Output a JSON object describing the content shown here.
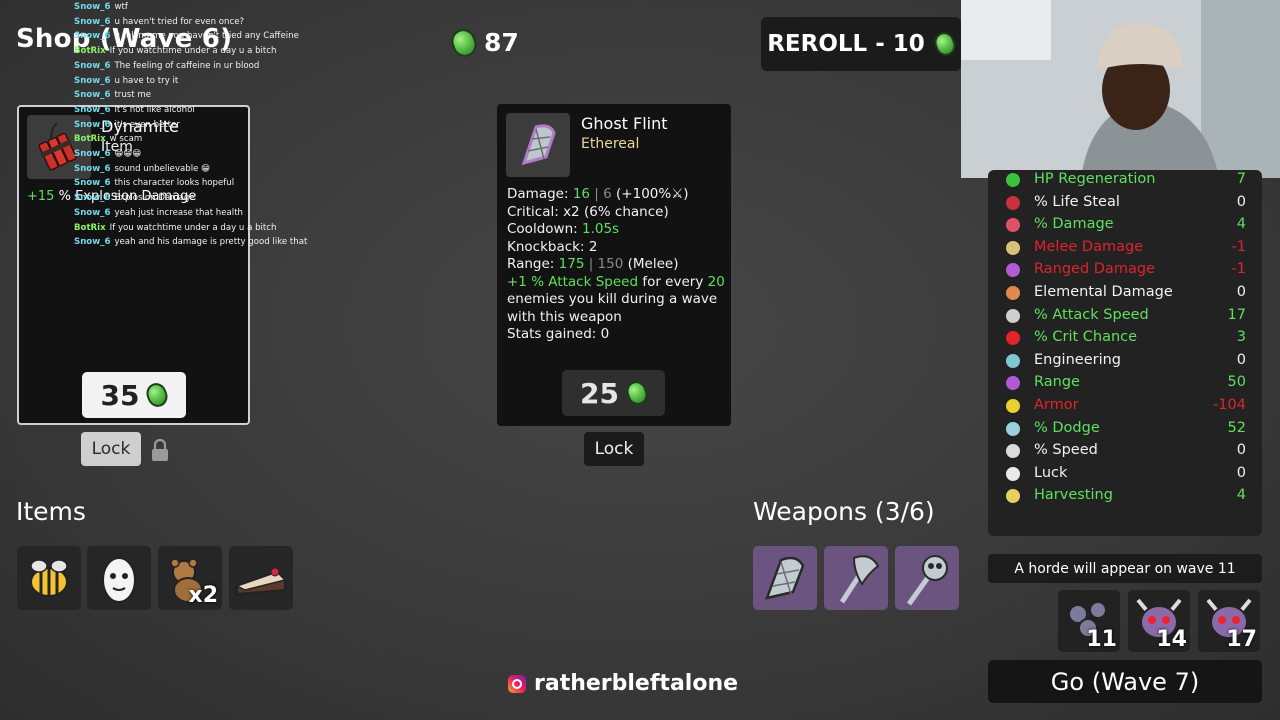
{
  "header": {
    "shop_title": "Shop (Wave 6)",
    "materials": "87",
    "reroll_label": "REROLL - 10"
  },
  "chat": [
    {
      "user": "Snow_6",
      "msg": "wtf"
    },
    {
      "user": "Snow_6",
      "msg": "u haven't tried for even once?"
    },
    {
      "user": "Snow_6",
      "msg": "u telling me you haven't tried any Caffeine"
    },
    {
      "user": "BotRix",
      "msg": "If you watchtime under a day u a bitch"
    },
    {
      "user": "Snow_6",
      "msg": "The feeling of caffeine in ur blood"
    },
    {
      "user": "Snow_6",
      "msg": "u have to try it"
    },
    {
      "user": "Snow_6",
      "msg": "trust me"
    },
    {
      "user": "Snow_6",
      "msg": "it's not like alcohol"
    },
    {
      "user": "Snow_6",
      "msg": "it's even better"
    },
    {
      "user": "BotRix",
      "msg": "w scam"
    },
    {
      "user": "Snow_6",
      "msg": "😁😁😁"
    },
    {
      "user": "Snow_6",
      "msg": "sound unbelievable 😁"
    },
    {
      "user": "Snow_6",
      "msg": "this character looks hopeful"
    },
    {
      "user": "Snow_6",
      "msg": "Explosion Damage"
    },
    {
      "user": "Snow_6",
      "msg": "yeah just increase that health"
    },
    {
      "user": "BotRix",
      "msg": "If you watchtime under a day u a bitch"
    },
    {
      "user": "Snow_6",
      "msg": "yeah and his damage is pretty good like that"
    }
  ],
  "shop": [
    {
      "name": "Dynamite",
      "type": "Item",
      "effect_value": "+15",
      "effect_text": "% Explosion Damage",
      "price": "35",
      "lock_label": "Lock"
    },
    {
      "name": "Ghost Flint",
      "type": "Ethereal",
      "stats": {
        "damage_label": "Damage:",
        "damage_value": "16",
        "damage_base": "| 6",
        "damage_scale": "(+100%⚔)",
        "critical_label": "Critical:",
        "critical_mult": "x2",
        "critical_pct": "(6% chance)",
        "cooldown_label": "Cooldown:",
        "cooldown_value": "1.05s",
        "knockback_label": "Knockback:",
        "knockback_value": "2",
        "range_label": "Range:",
        "range_value": "175",
        "range_base": "| 150",
        "range_type": "(Melee)",
        "bonus_value": "+1 % Attack Speed",
        "bonus_text_1": "for every",
        "bonus_kills": "20",
        "bonus_text_2": "enemies you kill during a wave with this weapon",
        "gained": "Stats gained: 0"
      },
      "price": "25",
      "lock_label": "Lock"
    }
  ],
  "items": {
    "title": "Items",
    "slots": [
      {
        "icon": "bee-icon",
        "count": ""
      },
      {
        "icon": "egg-icon",
        "count": ""
      },
      {
        "icon": "teddy-bear-icon",
        "count": "x2"
      },
      {
        "icon": "cake-slice-icon",
        "count": ""
      }
    ]
  },
  "weapons": {
    "title": "Weapons (3/6)",
    "slots": [
      {
        "icon": "ghost-flint-icon"
      },
      {
        "icon": "ghost-axe-icon"
      },
      {
        "icon": "ghost-scepter-icon"
      }
    ]
  },
  "stats": [
    {
      "label": "HP Regeneration",
      "value": "7",
      "color": "green",
      "icon": "heart-icon"
    },
    {
      "label": "% Life Steal",
      "value": "0",
      "color": "white",
      "icon": "fang-icon"
    },
    {
      "label": "% Damage",
      "value": "4",
      "color": "green",
      "icon": "muscle-icon"
    },
    {
      "label": "Melee Damage",
      "value": "-1",
      "color": "red",
      "icon": "sword-icon"
    },
    {
      "label": "Ranged Damage",
      "value": "-1",
      "color": "red",
      "icon": "bow-icon"
    },
    {
      "label": "Elemental Damage",
      "value": "0",
      "color": "white",
      "icon": "flame-icon"
    },
    {
      "label": "% Attack Speed",
      "value": "17",
      "color": "green",
      "icon": "hourglass-icon"
    },
    {
      "label": "% Crit Chance",
      "value": "3",
      "color": "green",
      "icon": "crit-icon"
    },
    {
      "label": "Engineering",
      "value": "0",
      "color": "white",
      "icon": "wrench-icon"
    },
    {
      "label": "Range",
      "value": "50",
      "color": "green",
      "icon": "range-icon"
    },
    {
      "label": "Armor",
      "value": "-104",
      "color": "red",
      "icon": "shield-icon"
    },
    {
      "label": "% Dodge",
      "value": "52",
      "color": "green",
      "icon": "dodge-icon"
    },
    {
      "label": "% Speed",
      "value": "0",
      "color": "white",
      "icon": "boot-icon"
    },
    {
      "label": "Luck",
      "value": "0",
      "color": "white",
      "icon": "dice-icon"
    },
    {
      "label": "Harvesting",
      "value": "4",
      "color": "green",
      "icon": "wheat-icon"
    }
  ],
  "horde": {
    "text": "A horde will appear on wave 11",
    "enemies": [
      {
        "icon": "bug-swarm-icon",
        "count": "11"
      },
      {
        "icon": "horned-skull-icon",
        "count": "14"
      },
      {
        "icon": "horned-skull-icon",
        "count": "17"
      }
    ]
  },
  "go_label": "Go (Wave 7)",
  "instagram": "ratherbleftalone",
  "colors": {
    "positive": "#5fe05f",
    "negative": "#e0242a",
    "material": "#5cc24a"
  }
}
